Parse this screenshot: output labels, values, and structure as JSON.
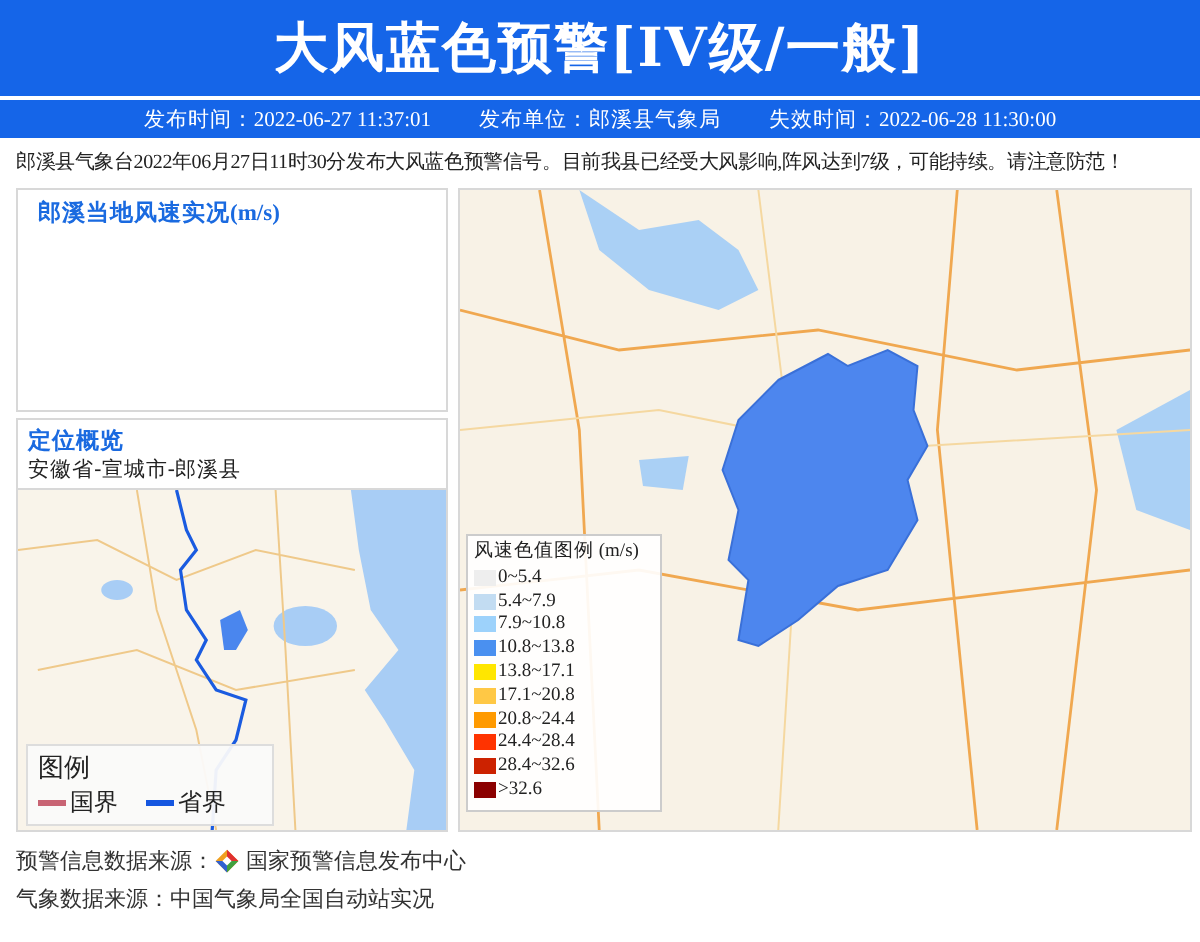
{
  "header": {
    "title": "大风蓝色预警[IV级/一般]"
  },
  "meta": [
    {
      "label": "发布时间：",
      "value": "2022-06-27 11:37:01"
    },
    {
      "label": "发布单位：",
      "value": "郎溪县气象局"
    },
    {
      "label": "失效时间：",
      "value": "2022-06-28 11:30:00"
    }
  ],
  "message": "郎溪县气象台2022年06月27日11时30分发布大风蓝色预警信号。目前我县已经受大风影响,阵风达到7级，可能持续。请注意防范！",
  "wind_panel": {
    "title": "郎溪当地风速实况(m/s)"
  },
  "location_panel": {
    "title": "定位概览",
    "region": "安徽省-宣城市-郎溪县",
    "legend": {
      "title": "图例",
      "items": [
        {
          "label": "国界",
          "color": "#c86474"
        },
        {
          "label": "省界",
          "color": "#1556e0"
        }
      ]
    }
  },
  "wind_legend": {
    "title": "风速色值图例 (m/s)",
    "items": [
      {
        "label": "0~5.4",
        "color": "#eeeeee"
      },
      {
        "label": "5.4~7.9",
        "color": "#c2dcf2"
      },
      {
        "label": "7.9~10.8",
        "color": "#9dd2fb"
      },
      {
        "label": "10.8~13.8",
        "color": "#4a90f0"
      },
      {
        "label": "13.8~17.1",
        "color": "#ffe600"
      },
      {
        "label": "17.1~20.8",
        "color": "#ffc845"
      },
      {
        "label": "20.8~24.4",
        "color": "#ff9a00"
      },
      {
        "label": "24.4~28.4",
        "color": "#ff3300"
      },
      {
        "label": "28.4~32.6",
        "color": "#cc2200"
      },
      {
        "label": ">32.6",
        "color": "#8b0000"
      }
    ]
  },
  "sources": [
    {
      "label": "预警信息数据来源：",
      "value": "国家预警信息发布中心",
      "logo": true
    },
    {
      "label": "气象数据来源：",
      "value": "中国气象局全国自动站实况",
      "logo": false
    }
  ]
}
